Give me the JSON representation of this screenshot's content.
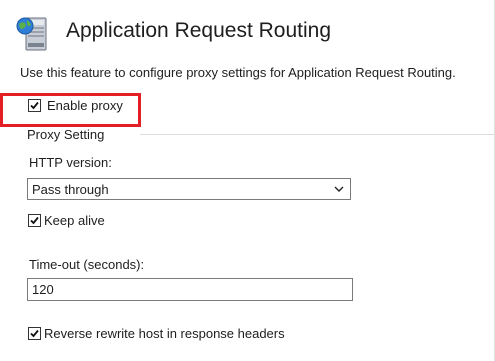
{
  "header": {
    "title": "Application Request Routing",
    "icon": "server-globe-icon"
  },
  "description": "Use this feature to configure proxy settings for Application Request Routing.",
  "enable_proxy": {
    "label": "Enable proxy",
    "checked": true
  },
  "proxy_setting": {
    "section_label": "Proxy Setting",
    "http_version": {
      "label": "HTTP version:",
      "value": "Pass through"
    },
    "keep_alive": {
      "label": "Keep alive",
      "checked": true
    },
    "timeout": {
      "label": "Time-out (seconds):",
      "value": "120"
    },
    "reverse_rewrite": {
      "label": "Reverse rewrite host in response headers",
      "checked": true
    }
  },
  "colors": {
    "highlight": "#e31e24",
    "text": "#1e1e1e"
  }
}
